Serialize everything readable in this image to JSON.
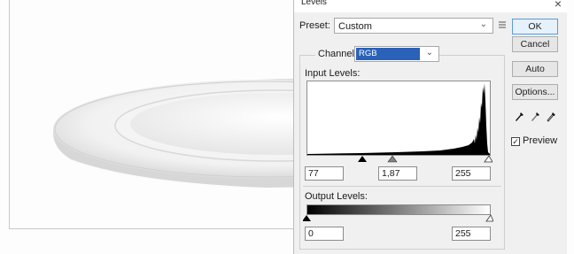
{
  "dialog": {
    "title": "Levels",
    "close_glyph": "×",
    "preset_label": "Preset:",
    "preset_value": "Custom",
    "channel_label": "Channel:",
    "channel_value": "RGB",
    "input_levels_label": "Input Levels:",
    "input_black": "77",
    "input_gamma": "1,87",
    "input_white": "255",
    "output_levels_label": "Output Levels:",
    "output_black": "0",
    "output_white": "255",
    "buttons": {
      "ok": "OK",
      "cancel": "Cancel",
      "auto": "Auto",
      "options": "Options..."
    },
    "preview_label": "Preview",
    "preview_checked": true
  },
  "icons": {
    "chevron": "chevron-down-icon",
    "preset_menu": "preset-menu-icon",
    "eyedroppers": [
      "black-eyedropper-icon",
      "gray-eyedropper-icon",
      "white-eyedropper-icon"
    ]
  },
  "colors": {
    "channel_highlight": "#2a62b8",
    "ok_border": "#5b9bd5"
  }
}
